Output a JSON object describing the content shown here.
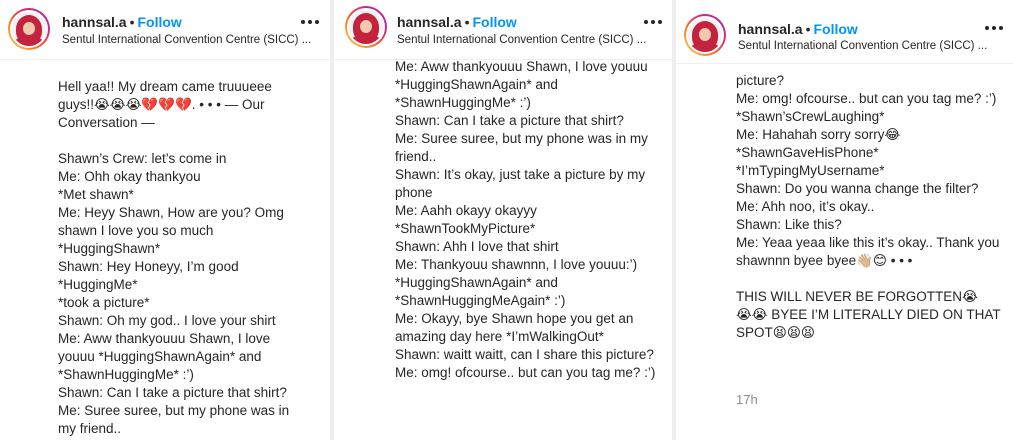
{
  "post": {
    "username": "hannsal.a",
    "separator": "•",
    "follow_label": "Follow",
    "location": "Sentul International Convention Centre (SICC) ..."
  },
  "panels": [
    {
      "caption": "Hell yaa!! My dream came truuueee guys!!😭😭😭💔💔💔. • • • — Our Conversation —\n\nShawn’s Crew: let’s come in\nMe: Ohh okay thankyou\n*Met shawn*\nMe: Heyy Shawn, How are you? Omg shawn I love you so much *HuggingShawn*\nShawn: Hey Honeyy, I’m good *HuggingMe*\n*took a picture*\nShawn: Oh my god.. I love your shirt\nMe: Aww thankyouuu Shawn, I love youuu *HuggingShawnAgain* and *ShawnHuggingMe* :’)\nShawn: Can I take a picture that shirt?\nMe: Suree suree, but my phone was in my friend.."
    },
    {
      "caption": "Me: Aww thankyouuu Shawn, I love youuu *HuggingShawnAgain* and *ShawnHuggingMe* :’)\nShawn: Can I take a picture that shirt?\nMe: Suree suree, but my phone was in my friend..\nShawn: It’s okay, just take a picture by my phone\nMe: Aahh okayy okayyy *ShawnTookMyPicture*\nShawn: Ahh I love that shirt\nMe: Thankyouu shawnnn, I love youuu:’) *HuggingShawnAgain* and *ShawnHuggingMeAgain* :’)\nMe: Okayy, bye Shawn hope you get an amazing day here *I’mWalkingOut*\nShawn: waitt waitt, can I share this picture?\nMe: omg! ofcourse.. but can you tag me? :’)"
    },
    {
      "caption": "picture?\nMe: omg! ofcourse.. but can you tag me? :’)\n*Shawn’sCrewLaughing*\nMe: Hahahah sorry sorry😂\n*ShawnGaveHisPhone*\n*I’mTypingMyUsername*\nShawn: Do you wanna change the filter?\nMe: Ahh noo, it’s okay..\nShawn: Like this?\nMe: Yeaa yeaa like this it’s okay.. Thank you shawnnn byee byee👋🏼😊 • • •\n\nTHIS WILL NEVER BE FORGOTTEN😭\n😭😭 BYEE I’M LITERALLY DIED ON THAT SPOT😫😫😫",
      "timestamp": "17h"
    }
  ],
  "colors": {
    "follow": "#0095f6",
    "text": "#262626",
    "muted": "#8e8e8e",
    "divider": "#eeeeee"
  },
  "icons": [
    "profile-avatar",
    "more-options-icon"
  ]
}
